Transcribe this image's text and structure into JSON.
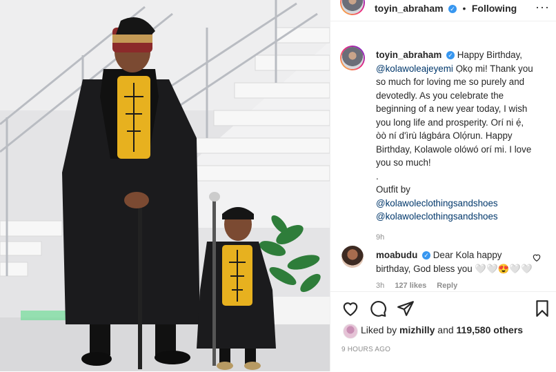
{
  "post": {
    "author": "toyin_abraham",
    "follow_state": "Following",
    "caption_user": "toyin_abraham",
    "caption_lines": [
      "Happy Birthday,",
      "@kolawoleajeyemi Ọkọ mi! Thank you",
      "so much for loving me so purely and",
      "devotedly. As you celebrate the",
      "beginning of a new year today, I wish",
      "you long life and prosperity. Orí ni ẹ́,",
      "òò ní d'ìrù lágbára Olọ́run. Happy",
      "Birthday, Kolawole olówó orí mi. I love",
      "you so much!",
      ".",
      "Outfit by"
    ],
    "outfit_mentions": [
      "@kolawoleclothingsandshoes",
      "@kolawoleclothingsandshoes"
    ],
    "caption_time": "9h"
  },
  "comment": {
    "user": "moabudu",
    "line1": "Dear Kola happy",
    "line2": "birthday, God bless you 🤍🤍😍🤍🤍",
    "meta_time": "3h",
    "meta_likes": "127 likes",
    "meta_reply": "Reply"
  },
  "likes": {
    "prefix": "Liked by",
    "user": "mizhilly",
    "middle": "and",
    "others": "119,580 others"
  },
  "timestamp": "9 HOURS AGO",
  "colors": {
    "accent": "#3897f0",
    "mention": "#00376b",
    "muted": "#8e8e8e"
  },
  "icons": [
    "heart-icon",
    "comment-icon",
    "share-icon",
    "bookmark-icon",
    "more-icon",
    "verified-icon"
  ]
}
